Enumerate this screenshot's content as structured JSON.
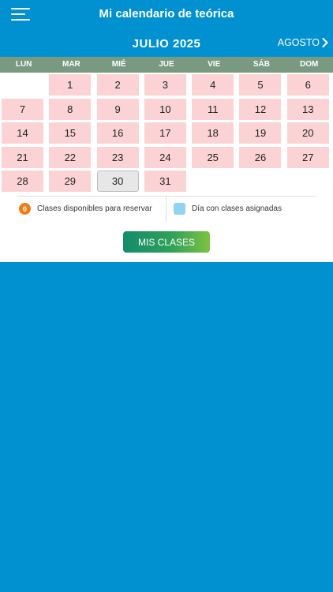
{
  "app": {
    "title": "Mi calendario de teórica"
  },
  "calendar": {
    "month_title": "JULIO 2025",
    "next_month_label": "AGOSTO",
    "weekdays": [
      "LUN",
      "MAR",
      "MIÉ",
      "JUE",
      "VIE",
      "SÁB",
      "DOM"
    ],
    "days": [
      "1",
      "2",
      "3",
      "4",
      "5",
      "6",
      "7",
      "8",
      "9",
      "10",
      "11",
      "12",
      "13",
      "14",
      "15",
      "16",
      "17",
      "18",
      "19",
      "20",
      "21",
      "22",
      "23",
      "24",
      "25",
      "26",
      "27",
      "28",
      "29",
      "30",
      "31"
    ],
    "today": "30"
  },
  "legend": {
    "available_badge": "0",
    "available_label": "Clases disponibles para reservar",
    "assigned_label": "Día con clases asignadas"
  },
  "actions": {
    "my_classes_label": "MIS CLASES"
  },
  "colors": {
    "primary": "#0291d0",
    "weekday_bar": "#799a80",
    "day_available": "#fcd3d4",
    "today_bg": "#e7e7e7",
    "badge_orange": "#f07d1a",
    "assigned_blue": "#8fd4f3",
    "button_green": "#2ea05a"
  },
  "icons": {
    "menu": "hamburger-menu-icon",
    "next": "chevron-right-icon"
  }
}
